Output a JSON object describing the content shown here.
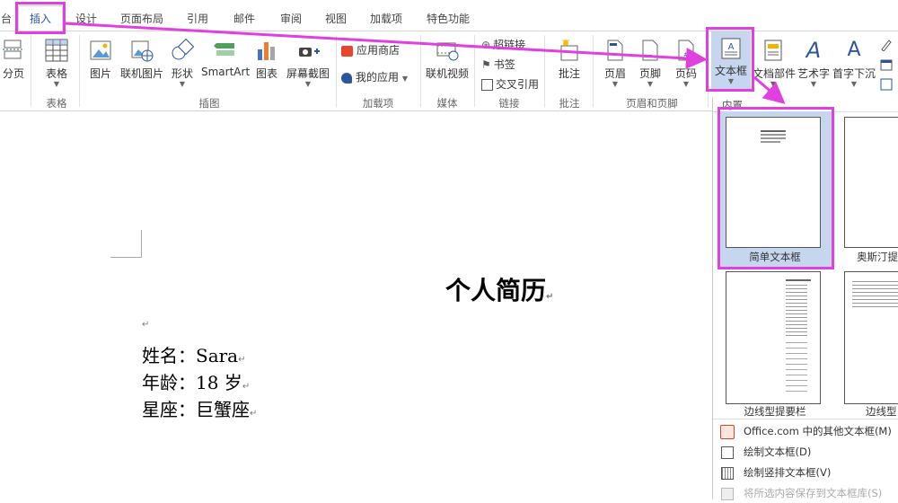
{
  "window_title": "…",
  "tabs": [
    {
      "label": "台"
    },
    {
      "label": "插入"
    },
    {
      "label": "设计"
    },
    {
      "label": "页面布局"
    },
    {
      "label": "引用"
    },
    {
      "label": "邮件"
    },
    {
      "label": "审阅"
    },
    {
      "label": "视图"
    },
    {
      "label": "加载项"
    },
    {
      "label": "特色功能"
    }
  ],
  "ribbon": {
    "page_break": "分页",
    "table": "表格",
    "picture": "图片",
    "online_picture": "联机图片",
    "shapes": "形状",
    "smartart": "SmartArt",
    "chart": "图表",
    "screenshot": "屏幕截图",
    "app_store": "应用商店",
    "my_apps": "我的应用",
    "online_video": "联机视频",
    "hyperlink": "超链接",
    "bookmark": "书签",
    "cross_reference": "交叉引用",
    "comment": "批注",
    "header": "页眉",
    "footer": "页脚",
    "page_number": "页码",
    "textbox": "文本框",
    "quick_parts": "文档部件",
    "wordart": "艺术字",
    "drop_cap": "首字下沉",
    "groups": {
      "tables": "表格",
      "illustrations": "插图",
      "addins": "加载项",
      "media": "媒体",
      "links": "链接",
      "comments": "批注",
      "header_footer": "页眉和页脚"
    }
  },
  "document": {
    "title": "个人简历",
    "lines": [
      "姓名：Sara",
      "年龄：18 岁",
      "星座：巨蟹座"
    ],
    "para_mark": "↵"
  },
  "gallery": {
    "section": "内置",
    "items": [
      "简单文本框",
      "奥斯汀提",
      "边线型提要栏",
      "边线型"
    ],
    "menu": [
      "Office.com 中的其他文本框(M)",
      "绘制文本框(D)",
      "绘制竖排文本框(V)",
      "将所选内容保存到文本框库(S)"
    ]
  },
  "colors": {
    "accent": "#2b579a",
    "highlight": "#e040e0",
    "selected_bg": "#c5d6ee"
  }
}
